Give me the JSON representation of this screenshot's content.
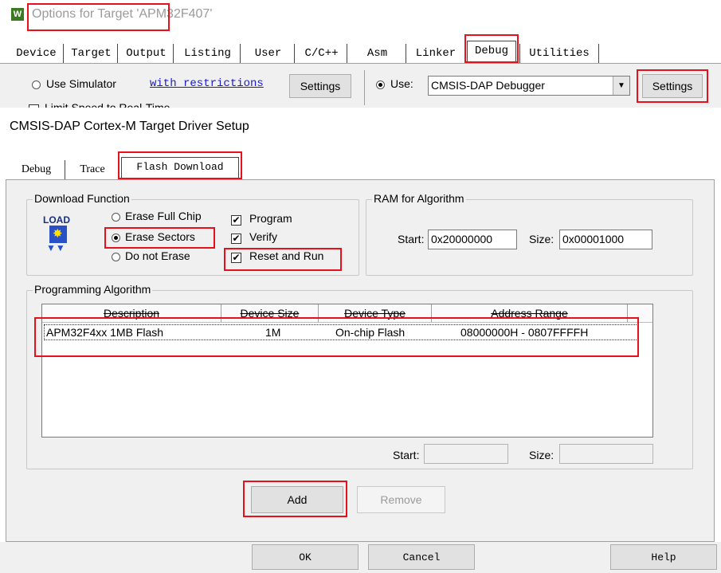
{
  "options_window": {
    "title": "Options for Target 'APM32F407'",
    "tabs": [
      "Device",
      "Target",
      "Output",
      "Listing",
      "User",
      "C/C++",
      "Asm",
      "Linker",
      "Debug",
      "Utilities"
    ],
    "active_tab": "Debug",
    "use_simulator_label": "Use Simulator",
    "with_restrictions_link": "with restrictions",
    "settings_left_label": "Settings",
    "use_label": "Use:",
    "debugger_value": "CMSIS-DAP Debugger",
    "settings_right_label": "Settings",
    "limit_speed_label": "Limit Speed to Real-Time"
  },
  "driver_setup": {
    "title": "CMSIS-DAP Cortex-M Target Driver Setup",
    "tabs": [
      "Debug",
      "Trace",
      "Flash Download"
    ],
    "active_tab": "Flash Download",
    "download_function": {
      "label": "Download Function",
      "load_text": "LOAD",
      "erase_full_chip": "Erase Full Chip",
      "erase_sectors": "Erase Sectors",
      "do_not_erase": "Do not Erase",
      "selected": "Erase Sectors",
      "program": "Program",
      "verify": "Verify",
      "reset_and_run": "Reset and Run",
      "program_checked": true,
      "verify_checked": true,
      "reset_and_run_checked": true
    },
    "ram_for_algorithm": {
      "label": "RAM for Algorithm",
      "start_label": "Start:",
      "start_value": "0x20000000",
      "size_label": "Size:",
      "size_value": "0x00001000"
    },
    "programming_algorithm": {
      "label": "Programming Algorithm",
      "columns": [
        "Description",
        "Device Size",
        "Device Type",
        "Address Range"
      ],
      "rows": [
        {
          "description": "APM32F4xx 1MB Flash",
          "size": "1M",
          "type": "On-chip Flash",
          "range": "08000000H - 0807FFFFH"
        }
      ],
      "start_label": "Start:",
      "size_label": "Size:",
      "start_value": "",
      "size_value": ""
    },
    "add_label": "Add",
    "remove_label": "Remove",
    "ok_label": "OK",
    "cancel_label": "Cancel",
    "help_label": "Help"
  },
  "colors": {
    "highlight": "#e8101b",
    "dialog_bg": "#f0f0f0",
    "link": "#1a1ad0"
  }
}
